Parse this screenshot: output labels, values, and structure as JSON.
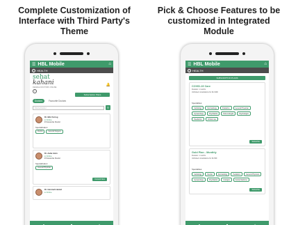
{
  "headings": {
    "left": "Complete Customization of Interface with Third Party's Theme",
    "right": "Pick & Choose Features to be customized in Integrated Module"
  },
  "app": {
    "title": "HBL Mobile",
    "section": "HEALTH",
    "menu_icon": "hamburger-icon",
    "home_icon": "home-icon",
    "back_icon": "back-circle-icon",
    "accent": "#3f9a6b"
  },
  "left_screen": {
    "logo_prefix": "sehat",
    "logo_main": "kahani",
    "tagline": "FEMALE DOCTORS ONLINE",
    "subscription_button": "Subscription Plans",
    "tabs": [
      "Doctors",
      "Favourite Doctors"
    ],
    "search_placeholder": "Find a Doctor",
    "doctors": [
      {
        "name": "Dr. Bibi Farrog",
        "status": "Online",
        "favourite": "Favourite Doctor",
        "specialization_label": "Specialization:",
        "chips": [
          "Dentist",
          "General Surgeon"
        ]
      },
      {
        "name": "Dr. Aalia Amin",
        "status": "Online",
        "favourite": "Favourite Doctor",
        "specialization_label": "Specialization:",
        "chips": [
          "General Physician"
        ],
        "consult": "Consult Now"
      },
      {
        "name": "Dr. Humnah Hamid",
        "status": "Online"
      }
    ],
    "nav_icons": [
      "home-icon",
      "chat-icon",
      "plus-icon"
    ]
  },
  "right_screen": {
    "banner": "SUBSCRIPTION PLANS",
    "plans": [
      {
        "title": "COVID-19 Care",
        "duration": "Duration: 1 months",
        "price": "Unlimited consultations for Rs 1999",
        "specialities_label": "Specialities:",
        "chips": [
          "Cardiology",
          "Dermatology",
          "Pediatrics",
          "General Physician",
          "Gynaecology",
          "Psychiatrist",
          "Pulmonologist",
          "Psychologist",
          "Paediatrics",
          "Critical care"
        ],
        "cta": "Subscribe"
      },
      {
        "title": "Gold Plan - Monthly",
        "duration": "Duration: 1 months",
        "price": "Unlimited consultations for Rs 999",
        "specialities_label": "Specialities:",
        "chips": [
          "Cardiology",
          "Dentist",
          "Dermatology",
          "Pediatrics",
          "General Physician",
          "Gynaecology",
          "Psychiatrist",
          "Urologist",
          "Family Medicine"
        ],
        "cta": "Subscribe"
      }
    ],
    "nav_icons": [
      "home-icon",
      "chat-icon",
      "plus-icon"
    ]
  }
}
